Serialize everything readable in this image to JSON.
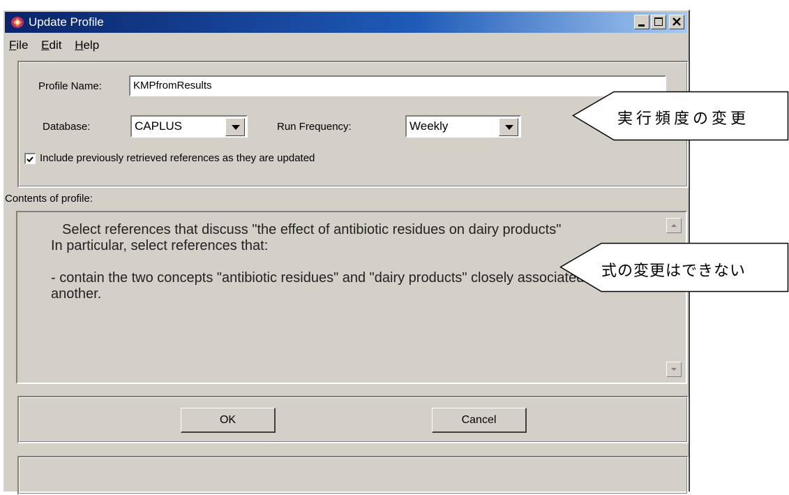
{
  "window": {
    "title": "Update Profile",
    "icon": "app-icon"
  },
  "menu": [
    {
      "label": "File",
      "mnemonic": "F",
      "rest": "ile"
    },
    {
      "label": "Edit",
      "mnemonic": "E",
      "rest": "dit"
    },
    {
      "label": "Help",
      "mnemonic": "H",
      "rest": "elp"
    }
  ],
  "form": {
    "profile_name_label": "Profile Name:",
    "profile_name_value": "KMPfromResults",
    "database_label": "Database:",
    "database_value": "CAPLUS",
    "run_frequency_label": "Run Frequency:",
    "run_frequency_value": "Weekly",
    "include_checkbox_label": "Include previously retrieved references as they are updated",
    "include_checked": true
  },
  "contents": {
    "label": "Contents of profile:",
    "lines": [
      "Select references that discuss \"the effect of antibiotic residues on dairy products\"",
      "In particular, select references that:",
      "",
      "- contain the two concepts \"antibiotic residues\" and \"dairy products\" closely associated with one another."
    ]
  },
  "buttons": {
    "ok": "OK",
    "cancel": "Cancel"
  },
  "callouts": {
    "frequency_note": "実行頻度の変更",
    "formula_note": "式の変更はできない"
  }
}
